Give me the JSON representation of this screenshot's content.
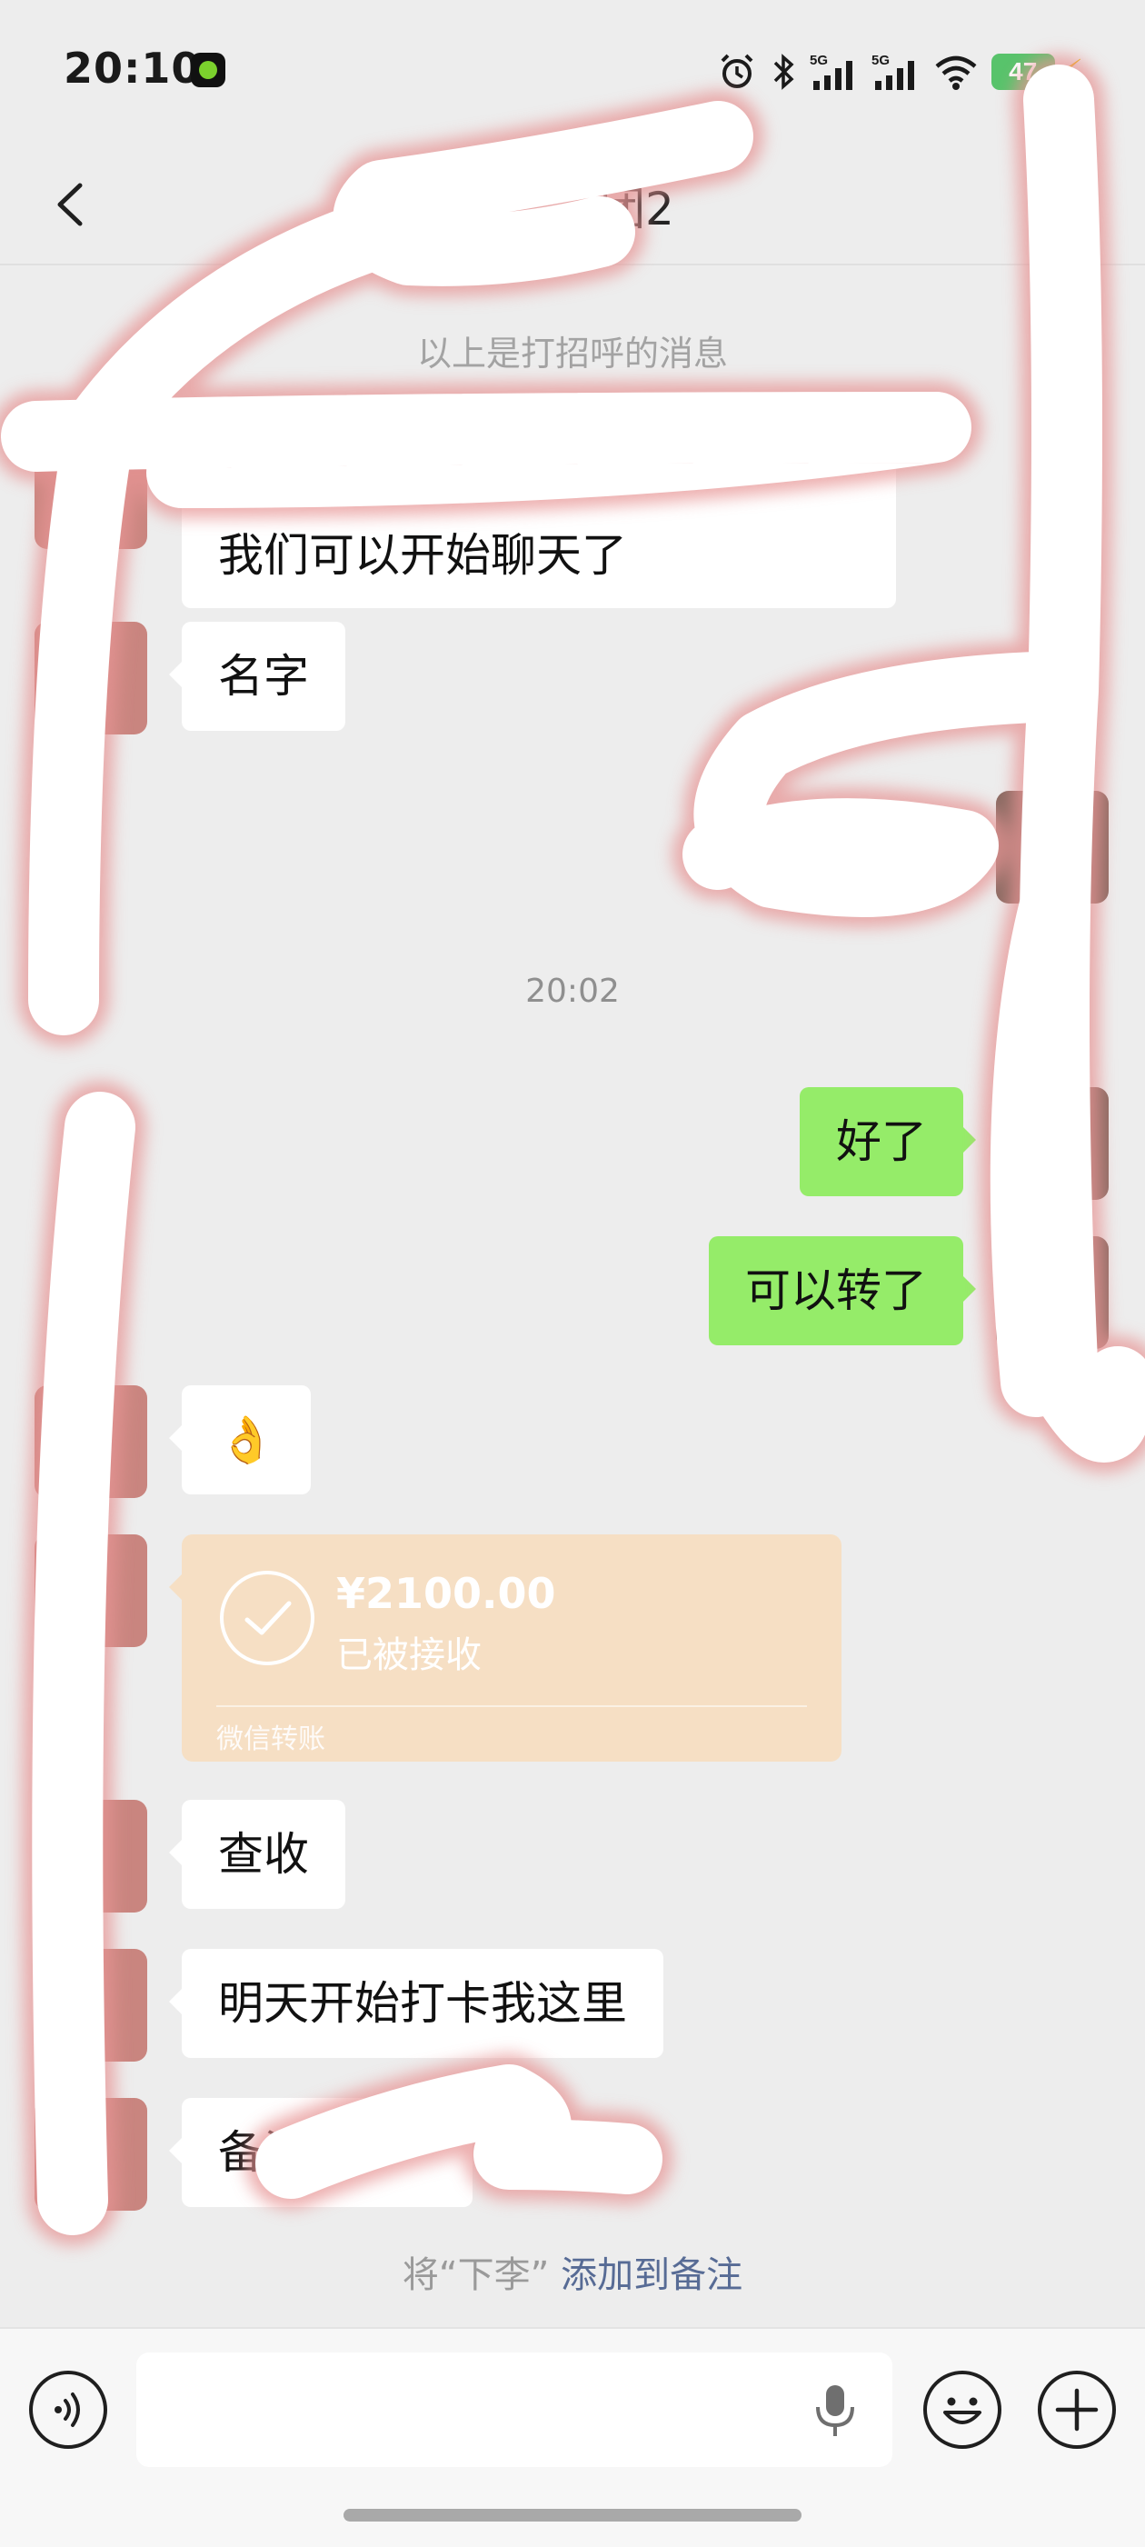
{
  "status_bar": {
    "time": "20:10",
    "signal_1": "5G",
    "signal_2": "5G",
    "battery": "47",
    "icons": [
      "alarm-icon",
      "bluetooth-icon",
      "signal-5g-icon",
      "signal-5g-icon",
      "wifi-icon",
      "battery-icon",
      "charging-icon"
    ]
  },
  "header": {
    "title": "团2",
    "back_icon": "chevron-left-icon"
  },
  "chat": {
    "greeting_note": "以上是打招呼的消息",
    "greeting_message": "我们可以开始聊天了",
    "timestamp": "20:02",
    "messages": [
      {
        "side": "in",
        "text": "名字"
      },
      {
        "side": "out",
        "text": "好了"
      },
      {
        "side": "out",
        "text": "可以转了"
      },
      {
        "side": "in",
        "text": "👌"
      },
      {
        "side": "in",
        "text": "查收"
      },
      {
        "side": "in",
        "text": "明天开始打卡我这里"
      },
      {
        "side": "in",
        "text": "备注"
      }
    ],
    "transfer": {
      "amount": "¥2100.00",
      "status": "已被接收",
      "source": "微信转账"
    },
    "remark_hint": {
      "prefix": "将“下李”",
      "link": "添加到备注"
    }
  },
  "input_bar": {
    "value": "",
    "icons": [
      "voice-icon",
      "microphone-icon",
      "emoji-icon",
      "plus-icon"
    ]
  },
  "colors": {
    "background": "#ededed",
    "outgoing_bubble": "#95ec69",
    "incoming_bubble": "#ffffff",
    "transfer_card": "#f6dfc4",
    "link": "#576b95"
  }
}
